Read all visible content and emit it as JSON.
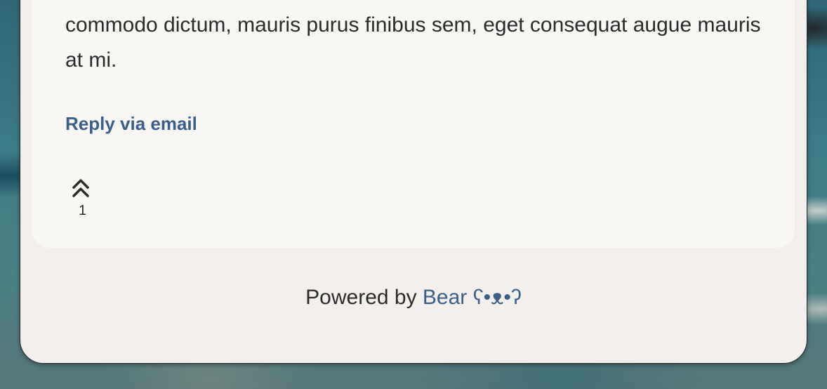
{
  "post": {
    "body_tail": "commodo dictum, mauris purus finibus sem, eget consequat augue mauris at mi.",
    "reply_label": "Reply via email"
  },
  "upvote": {
    "icon": "double-chevron-up-icon",
    "count": "1"
  },
  "footer": {
    "prefix": "Powered by ",
    "link_text": "Bear ʕ•ᴥ•ʔ"
  },
  "colors": {
    "link": "#3a6089",
    "text": "#2b2b2b",
    "card": "#f9f7f4",
    "page": "#f2efec"
  }
}
